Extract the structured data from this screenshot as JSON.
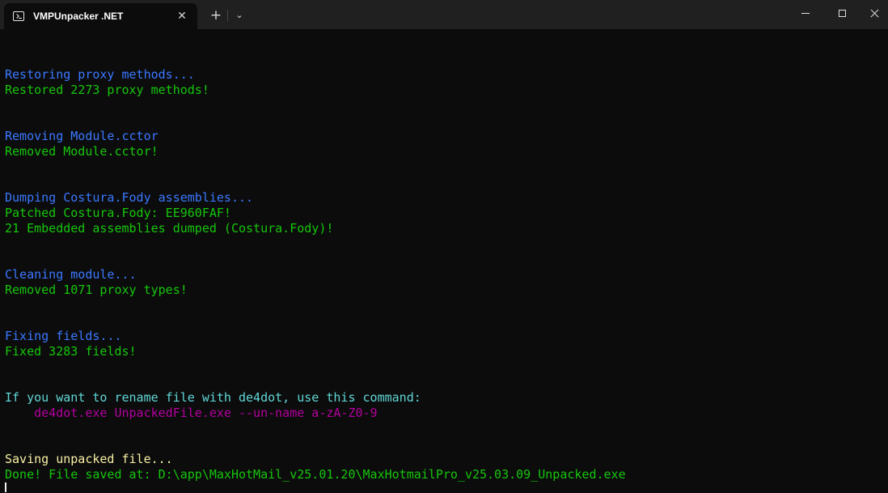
{
  "window": {
    "tab_title": "VMPUnpacker .NET",
    "tab_icon": "terminal-icon",
    "close_glyph": "✕",
    "new_tab_glyph": "+",
    "dropdown_glyph": "⌄"
  },
  "colors": {
    "background": "#0c0c0c",
    "titlebar": "#202020",
    "blue": "#3b78ff",
    "green": "#16c60c",
    "cyan": "#61d6d6",
    "magenta": "#b4009e",
    "yellow": "#f9f1a5"
  },
  "console": {
    "lines": [
      "Restoring proxy methods...",
      "Restored 2273 proxy methods!",
      "Removing Module.cctor",
      "Removed Module.cctor!",
      "Dumping Costura.Fody assemblies...",
      "Patched Costura.Fody: EE960FAF!",
      "21 Embedded assemblies dumped (Costura.Fody)!",
      "Cleaning module...",
      "Removed 1071 proxy types!",
      "Fixing fields...",
      "Fixed 3283 fields!",
      "If you want to rename file with de4dot, use this command:",
      "    de4dot.exe UnpackedFile.exe --un-name a-zA-Z0-9",
      "Saving unpacked file...",
      "Done! File saved at: D:\\app\\MaxHotMail_v25.01.20\\MaxHotmailPro_v25.03.09_Unpacked.exe"
    ]
  }
}
